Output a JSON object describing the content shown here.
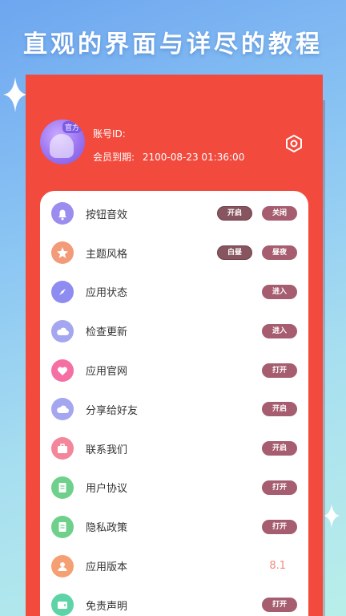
{
  "promo": {
    "title": "直观的界面与详尽的教程"
  },
  "profile": {
    "avatar_badge": "官方",
    "account_label": "账号ID:",
    "expiry_label": "会员到期:",
    "expiry_value": "2100-08-23 01:36:00"
  },
  "colors": {
    "screen_bg": "#f24a3d",
    "pill": "#a65d6f",
    "pill_dark": "#87555f",
    "version_text": "#f08a7b"
  },
  "settings": [
    {
      "label": "按钮音效",
      "icon": "bell-icon",
      "icon_color": "#9b8cf0",
      "buttons": [
        "开启",
        "关闭"
      ]
    },
    {
      "label": "主题风格",
      "icon": "star-icon",
      "icon_color": "#f39a78",
      "buttons": [
        "白昼",
        "昼夜"
      ]
    },
    {
      "label": "应用状态",
      "icon": "compass-icon",
      "icon_color": "#8e8cf0",
      "buttons": [
        "进入"
      ]
    },
    {
      "label": "检查更新",
      "icon": "cloud-icon",
      "icon_color": "#a4a7f0",
      "buttons": [
        "进入"
      ]
    },
    {
      "label": "应用官网",
      "icon": "heart-icon",
      "icon_color": "#f56fa3",
      "buttons": [
        "打开"
      ]
    },
    {
      "label": "分享给好友",
      "icon": "cloud-icon",
      "icon_color": "#a4a7f0",
      "buttons": [
        "开启"
      ]
    },
    {
      "label": "联系我们",
      "icon": "briefcase-icon",
      "icon_color": "#f3869a",
      "buttons": [
        "开启"
      ]
    },
    {
      "label": "用户协议",
      "icon": "document-icon",
      "icon_color": "#6fd08c",
      "buttons": [
        "打开"
      ]
    },
    {
      "label": "隐私政策",
      "icon": "document-icon",
      "icon_color": "#6fd08c",
      "buttons": [
        "打开"
      ]
    },
    {
      "label": "应用版本",
      "icon": "user-icon",
      "icon_color": "#f5a072",
      "value": "8.1"
    },
    {
      "label": "免责声明",
      "icon": "wallet-icon",
      "icon_color": "#5fd3a8",
      "buttons": [
        "打开"
      ]
    }
  ]
}
